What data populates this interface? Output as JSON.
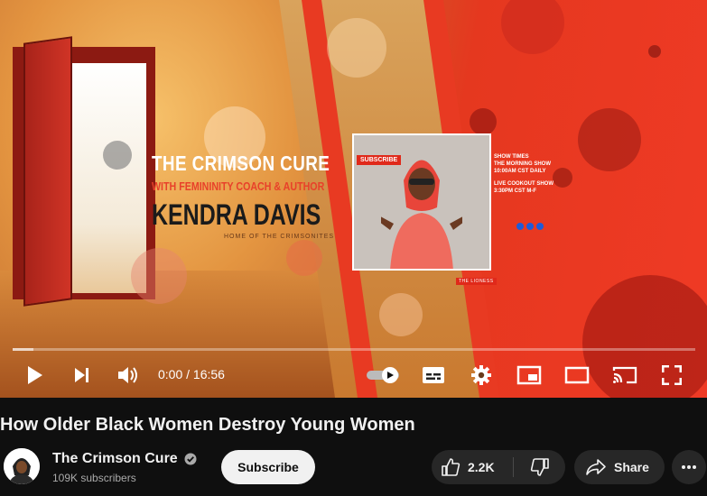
{
  "player": {
    "thumbnail": {
      "channel_title": "THE CRIMSON CURE",
      "subtitle": "WITH FEMININITY COACH & AUTHOR",
      "host_name": "KENDRA DAVIS",
      "tagline": "HOME OF THE CRIMSONITES",
      "subscribe_tag": "SUBSCRIBE",
      "lioness_tag": "THE LIONESS",
      "show_times": {
        "heading": "SHOW TIMES",
        "line1": "THE MORNING SHOW",
        "line2": "10:00AM CST DAILY",
        "line3": "LIVE COOKOUT SHOW",
        "line4": "3:30PM CST M-F"
      }
    },
    "progress": 0.0,
    "buffered": 0.03,
    "time_display": "0:00 / 16:56",
    "autoplay_on": true,
    "icons": [
      "play-icon",
      "next-icon",
      "volume-icon",
      "autoplay-toggle",
      "subtitles-icon",
      "settings-icon",
      "miniplayer-icon",
      "theater-icon",
      "cast-icon",
      "fullscreen-icon"
    ]
  },
  "video": {
    "title": "How Older Black Women Destroy Young Women"
  },
  "channel": {
    "name": "The Crimson Cure",
    "subscribers": "109K subscribers",
    "verified": true
  },
  "actions": {
    "subscribe_label": "Subscribe",
    "like_count": "2.2K",
    "share_label": "Share"
  },
  "colors": {
    "background": "#0f0f0f",
    "button_bg": "#272727",
    "subscribe_bg": "#f1f1f1",
    "brand_red": "#e83a22"
  }
}
